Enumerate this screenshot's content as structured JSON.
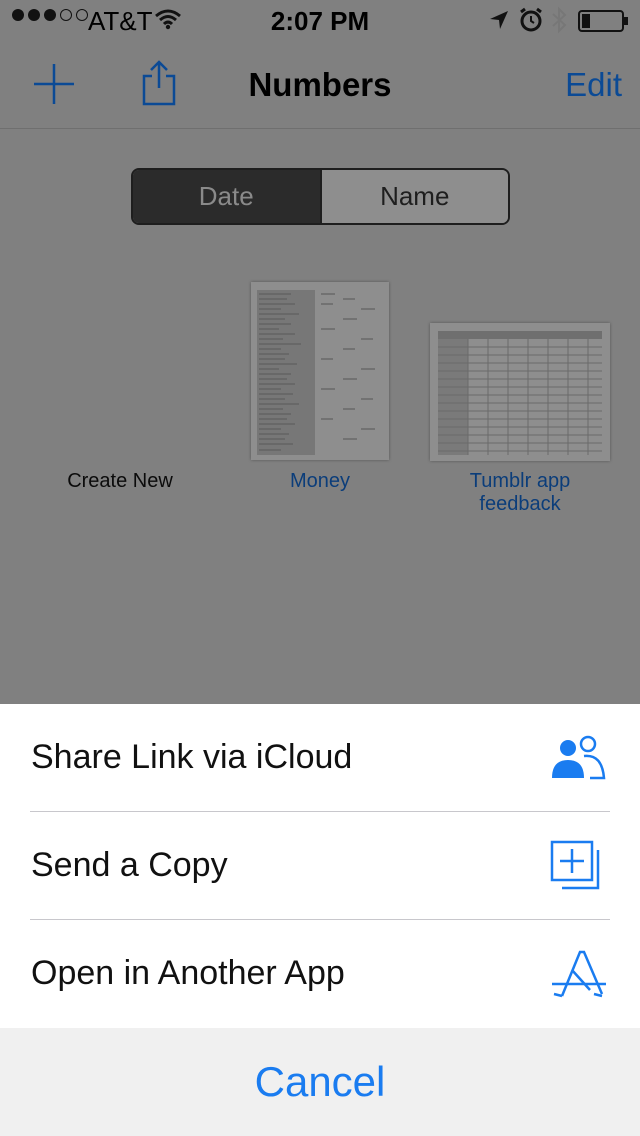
{
  "status_bar": {
    "carrier": "AT&T",
    "time": "2:07 PM",
    "signal_bars": 3,
    "signal_max": 5,
    "icons": [
      "wifi-icon",
      "location-arrow-icon",
      "alarm-icon",
      "bluetooth-icon",
      "battery-icon"
    ],
    "battery_level": 0.2
  },
  "nav": {
    "title": "Numbers",
    "edit_label": "Edit",
    "icons": [
      "plus-icon",
      "share-icon"
    ]
  },
  "sort_control": {
    "options": [
      "Date",
      "Name"
    ],
    "selected": "Date"
  },
  "documents": [
    {
      "name": "Create New"
    },
    {
      "name": "Money"
    },
    {
      "name": "Tumblr app feedback"
    }
  ],
  "action_sheet": {
    "items": [
      {
        "label": "Share Link via iCloud",
        "icon": "people-icon"
      },
      {
        "label": "Send a Copy",
        "icon": "copy-icon"
      },
      {
        "label": "Open in Another App",
        "icon": "app-store-icon"
      }
    ],
    "cancel_label": "Cancel"
  },
  "colors": {
    "accent": "#1a7cf0",
    "link_dimmed": "#0b3d7a",
    "dim_overlay": "#808080",
    "sheet_bg": "#ffffff"
  }
}
